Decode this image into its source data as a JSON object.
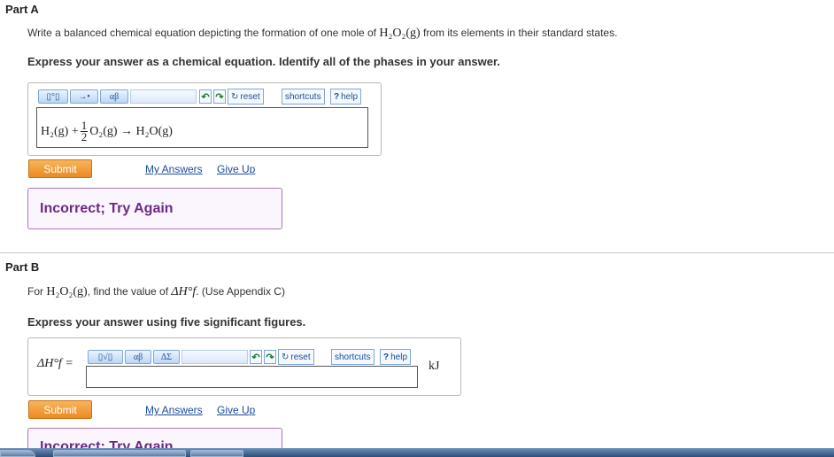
{
  "part_a": {
    "title": "Part A",
    "question_pre": "Write a balanced chemical equation depicting the formation of one mole of",
    "question_formula": "H₂O₂(g)",
    "question_post": "from its elements in their standard states.",
    "instruction": "Express your answer as a chemical equation. Identify all of the phases in your answer.",
    "toolbar": {
      "templates_label": "▯°▯",
      "arrows_label": "→•",
      "greek_label": "αβ",
      "reset_label": "reset",
      "shortcuts_label": "shortcuts",
      "help_label": "help"
    },
    "answer": {
      "h2": "H₂(g) +",
      "frac_num": "1",
      "frac_den": "2",
      "rest": "O₂(g) → H₂O(g)"
    },
    "submit_label": "Submit",
    "my_answers_label": "My Answers",
    "give_up_label": "Give Up",
    "feedback": "Incorrect; Try Again"
  },
  "part_b": {
    "title": "Part B",
    "question_pre": "For",
    "question_formula": "H₂O₂(g)",
    "question_mid": ", find the value of",
    "question_symbol": "ΔH°f",
    "question_post": ". (Use Appendix C)",
    "instruction": "Express your answer using five significant figures.",
    "label": "ΔH°f =",
    "toolbar": {
      "templates_label": "▯√▯",
      "greek_label": "αβ",
      "symbols_label": "ΔΣ",
      "reset_label": "reset",
      "shortcuts_label": "shortcuts",
      "help_label": "help"
    },
    "unit": "kJ",
    "submit_label": "Submit",
    "my_answers_label": "My Answers",
    "give_up_label": "Give Up",
    "feedback": "Incorrect; Try Again"
  }
}
